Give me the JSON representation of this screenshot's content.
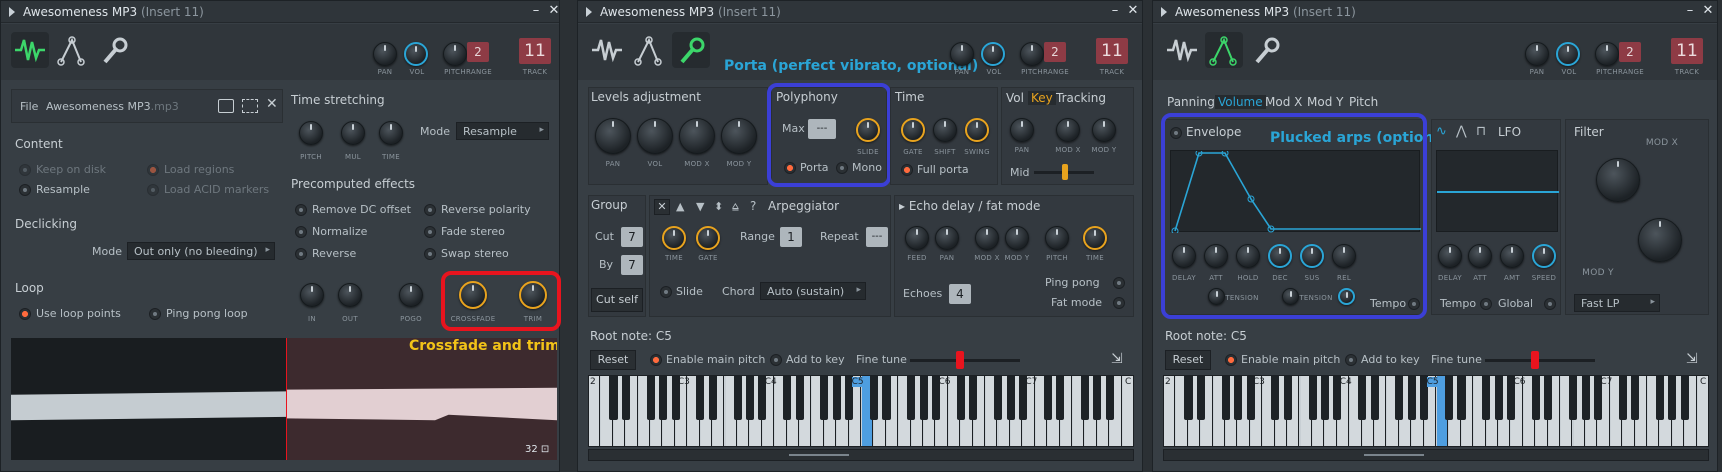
{
  "windows": [
    {
      "title": "Awesomeness MP3",
      "insert": "(Insert 11)"
    },
    {
      "title": "Awesomeness MP3",
      "insert": "(Insert 11)"
    },
    {
      "title": "Awesomeness MP3",
      "insert": "(Insert 11)"
    }
  ],
  "toolbar": {
    "pan": "PAN",
    "vol": "VOL",
    "pitch": "PITCH",
    "range": "RANGE",
    "track": "TRACK",
    "pitch_range": "2",
    "track_num": "11"
  },
  "w1": {
    "file_label": "File",
    "file_name": "Awesomeness MP3",
    "file_ext": ".mp3",
    "content": {
      "title": "Content",
      "keep_on_disk": "Keep on disk",
      "load_regions": "Load regions",
      "resample": "Resample",
      "load_acid": "Load ACID markers"
    },
    "declicking": {
      "title": "Declicking",
      "mode_label": "Mode",
      "mode_value": "Out only (no bleeding)"
    },
    "loop": {
      "title": "Loop",
      "use_loop_points": "Use loop points",
      "ping_pong": "Ping pong loop"
    },
    "time_stretching": {
      "title": "Time stretching",
      "pitch": "PITCH",
      "mul": "MUL",
      "time": "TIME",
      "mode_label": "Mode",
      "mode_value": "Resample"
    },
    "precomputed": {
      "title": "Precomputed effects",
      "remove_dc": "Remove DC offset",
      "reverse_polarity": "Reverse polarity",
      "normalize": "Normalize",
      "fade_stereo": "Fade stereo",
      "reverse": "Reverse",
      "swap_stereo": "Swap stereo",
      "in": "IN",
      "out": "OUT",
      "pogo": "POGO",
      "crossfade": "CROSSFADE",
      "trim": "TRIM"
    },
    "annotation": "Crossfade and trim",
    "wave_counter": "32"
  },
  "w2": {
    "annotation": "Porta (perfect vibrato, optional)",
    "levels": {
      "title": "Levels adjustment",
      "pan": "PAN",
      "vol": "VOL",
      "modx": "MOD X",
      "mody": "MOD Y"
    },
    "polyphony": {
      "title": "Polyphony",
      "max": "Max",
      "max_value": "---",
      "slide": "SLIDE",
      "porta": "Porta",
      "mono": "Mono"
    },
    "time": {
      "title": "Time",
      "gate": "GATE",
      "shift": "SHIFT",
      "swing": "SWING",
      "full_porta": "Full porta"
    },
    "vkt": {
      "vol": "Vol",
      "key": "Key",
      "tracking": "Tracking",
      "pan": "PAN",
      "modx": "MOD X",
      "mody": "MOD Y",
      "mid": "Mid"
    },
    "group": {
      "title": "Group",
      "cut": "Cut",
      "cut_value": "7",
      "by": "By",
      "by_value": "7",
      "cut_self": "Cut self"
    },
    "arp": {
      "title": "Arpeggiator",
      "time": "TIME",
      "gate": "GATE",
      "range": "Range",
      "range_value": "1",
      "repeat": "Repeat",
      "repeat_value": "---",
      "slide": "Slide",
      "chord": "Chord",
      "chord_value": "Auto (sustain)"
    },
    "echo": {
      "title": "Echo delay / fat mode",
      "feed": "FEED",
      "pan": "PAN",
      "modx": "MOD X",
      "mody": "MOD Y",
      "pitch": "PITCH",
      "time": "TIME",
      "echoes": "Echoes",
      "echoes_value": "4",
      "ping_pong": "Ping pong",
      "fat_mode": "Fat mode"
    },
    "root": {
      "label": "Root note: C5",
      "reset": "Reset",
      "enable_main_pitch": "Enable main pitch",
      "add_to_key": "Add to key",
      "fine_tune": "Fine tune"
    },
    "octaves": [
      "2",
      "C3",
      "C4",
      "C5",
      "C6",
      "C7",
      "C"
    ]
  },
  "w3": {
    "tabs": [
      "Panning",
      "Volume",
      "Mod X",
      "Mod Y",
      "Pitch"
    ],
    "active_tab": "Volume",
    "annotation": "Plucked arps (optional)",
    "envelope": {
      "title": "Envelope",
      "delay": "DELAY",
      "att": "ATT",
      "hold": "HOLD",
      "dec": "DEC",
      "sus": "SUS",
      "rel": "REL",
      "tension": "TENSION",
      "tension2": "TENSION",
      "tempo": "Tempo"
    },
    "lfo": {
      "title": "LFO",
      "delay": "DELAY",
      "att": "ATT",
      "amt": "AMT",
      "speed": "SPEED",
      "tempo": "Tempo",
      "global": "Global"
    },
    "filter": {
      "title": "Filter",
      "modx": "MOD X",
      "mody": "MOD Y",
      "type": "Fast LP"
    },
    "root": {
      "label": "Root note: C5",
      "reset": "Reset",
      "enable_main_pitch": "Enable main pitch",
      "add_to_key": "Add to key",
      "fine_tune": "Fine tune"
    },
    "octaves": [
      "2",
      "C3",
      "C4",
      "C5",
      "C6",
      "C7",
      "C"
    ]
  },
  "colors": {
    "accent": "#2aa5d6",
    "orange": "#e8a31e",
    "red_annotation": "#e8141e",
    "blue_annotation": "#3b3fd6",
    "yellow_text": "#f2c318",
    "blue_text": "#2aa5d6"
  }
}
